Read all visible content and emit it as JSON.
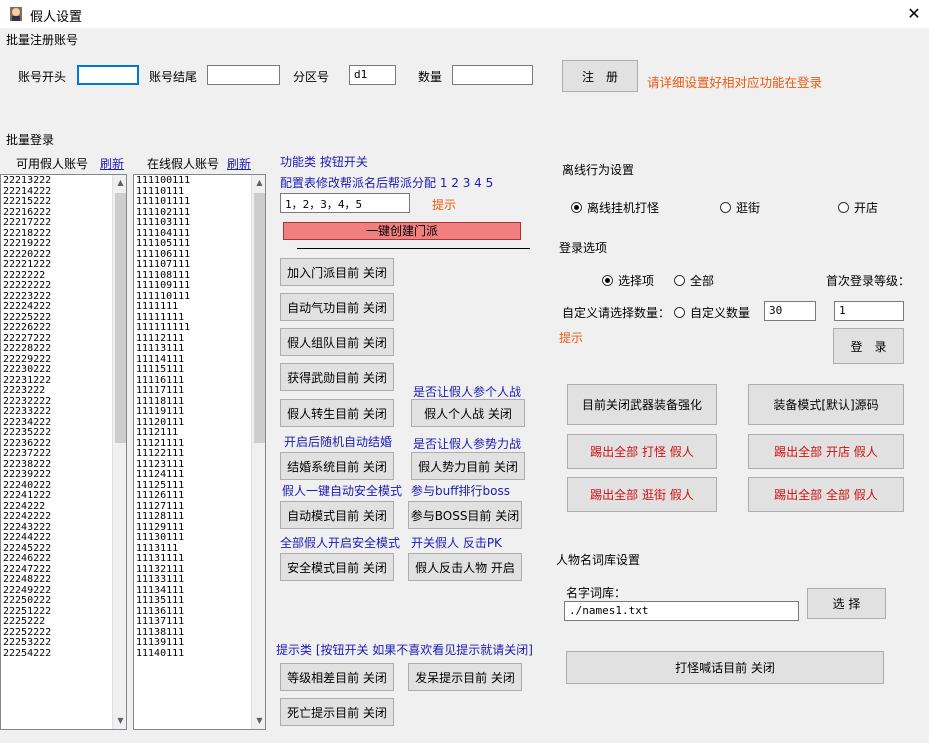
{
  "window": {
    "title": "假人设置",
    "close_glyph": "✕"
  },
  "batch_register": {
    "section_label": "批量注册账号",
    "account_start_label": "账号开头",
    "account_start_value": "",
    "account_end_label": "账号结尾",
    "account_end_value": "",
    "zone_label": "分区号",
    "zone_value": "d1",
    "count_label": "数量",
    "count_value": "",
    "register_button": "注　册",
    "hint": "请详细设置好相对应功能在登录"
  },
  "batch_login": {
    "section_label": "批量登录",
    "available_label": "可用假人账号",
    "available_refresh": "刷新",
    "online_label": "在线假人账号",
    "online_refresh": "刷新",
    "available_accounts": [
      "22213222",
      "22214222",
      "22215222",
      "22216222",
      "22217222",
      "22218222",
      "22219222",
      "22220222",
      "22221222",
      "2222222",
      "22222222",
      "22223222",
      "22224222",
      "22225222",
      "22226222",
      "22227222",
      "22228222",
      "22229222",
      "22230222",
      "22231222",
      "2223222",
      "22232222",
      "22233222",
      "22234222",
      "22235222",
      "22236222",
      "22237222",
      "22238222",
      "22239222",
      "22240222",
      "22241222",
      "2224222",
      "22242222",
      "22243222",
      "22244222",
      "22245222",
      "22246222",
      "22247222",
      "22248222",
      "22249222",
      "22250222",
      "22251222",
      "2225222",
      "22252222",
      "22253222",
      "22254222"
    ],
    "online_accounts": [
      "111100111",
      "11110111",
      "111101111",
      "111102111",
      "111103111",
      "111104111",
      "111105111",
      "111106111",
      "111107111",
      "111108111",
      "111109111",
      "111110111",
      "1111111",
      "11111111",
      "111111111",
      "11112111",
      "11113111",
      "11114111",
      "11115111",
      "11116111",
      "11117111",
      "11118111",
      "11119111",
      "11120111",
      "1112111",
      "11121111",
      "11122111",
      "11123111",
      "11124111",
      "11125111",
      "11126111",
      "11127111",
      "11128111",
      "11129111",
      "11130111",
      "1113111",
      "11131111",
      "11132111",
      "11133111",
      "11134111",
      "11135111",
      "11136111",
      "11137111",
      "11138111",
      "11139111",
      "11140111"
    ]
  },
  "function_panel": {
    "header": "功能类 按钮开关",
    "config_label": "配置表修改帮派名后帮派分配 1 2 3 4 5",
    "config_value": "1，2，3，4，5",
    "config_hint": "提示",
    "create_sect_button": "一键创建门派",
    "buttons": {
      "join_sect": "加入门派目前 关闭",
      "auto_qigong": "自动气功目前 关闭",
      "team_up": "假人组队目前 关闭",
      "get_honor": "获得武勋目前 关闭",
      "rebirth": "假人转生目前 关闭",
      "personal_war": "假人个人战 关闭",
      "marriage": "结婚系统目前 关闭",
      "faction_war": "假人势力目前 关闭",
      "auto_mode": "自动模式目前 关闭",
      "boss": "参与BOSS目前 关闭",
      "safe_mode": "安全模式目前 关闭",
      "counter_pk": "假人反击人物 开启"
    },
    "labels": {
      "personal_war_q": "是否让假人参个人战",
      "marriage_note": "开启后随机自动结婚",
      "faction_war_q": "是否让假人参势力战",
      "auto_safe": "假人一键自动安全模式",
      "boss_note": "参与buff排行boss",
      "all_safe": "全部假人开启安全模式",
      "counter_note": "开关假人 反击PK"
    },
    "tips_header": "提示类 [按钮开关 如果不喜欢看见提示就请关闭]",
    "tip_buttons": {
      "level_gap": "等级相差目前 关闭",
      "idle": "发呆提示目前 关闭",
      "death": "死亡提示目前 关闭"
    }
  },
  "offline": {
    "section_label": "离线行为设置",
    "options": [
      "离线挂机打怪",
      "逛街",
      "开店"
    ],
    "selected": "离线挂机打怪"
  },
  "login_options": {
    "section_label": "登录选项",
    "options": [
      "选择项",
      "全部"
    ],
    "selected": "选择项",
    "custom_label": "自定义请选择数量：",
    "custom_radio": "自定义数量",
    "custom_value": "30",
    "first_level_label": "首次登录等级：",
    "first_level_value": "1",
    "login_button": "登　录",
    "hint": "提示"
  },
  "actions": {
    "weapon_enhance": "目前关闭武器装备强化",
    "equip_mode": "装备模式[默认]源码",
    "kick_all_farm": "踢出全部 打怪 假人",
    "kick_all_shop": "踢出全部 开店 假人",
    "kick_all_stroll": "踢出全部 逛街 假人",
    "kick_all_all": "踢出全部 全部 假人"
  },
  "names": {
    "section_label": "人物名词库设置",
    "lib_label": "名字词库：",
    "lib_value": "./names1.txt",
    "select_button": "选 择",
    "shout_button": "打怪喊话目前 关闭"
  },
  "colors": {
    "accent_red": "#d21010",
    "hint_orange": "#e85a10",
    "link_blue": "#1a1ab8",
    "bar_red": "#f08080"
  }
}
